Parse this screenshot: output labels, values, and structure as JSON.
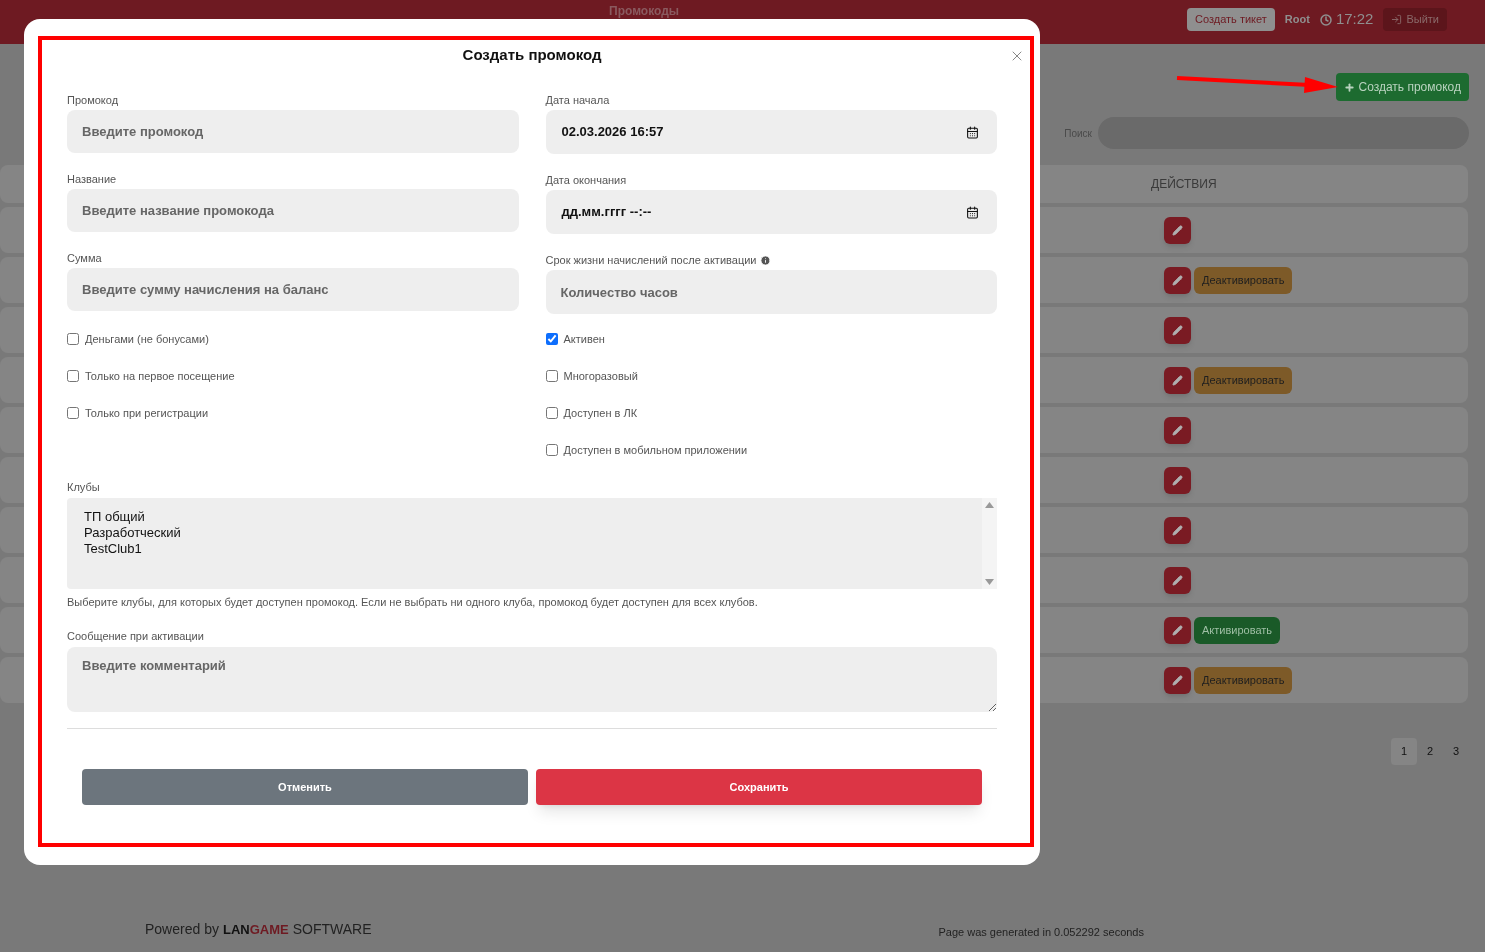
{
  "header": {
    "title": "Промокоды",
    "ticket_button": "Создать тикет",
    "user": "Root",
    "time": "17:22",
    "logout": "Выйти"
  },
  "toolbar": {
    "create_button": "Создать промокод",
    "search_label": "Поиск"
  },
  "table": {
    "columns": [
      "ДЕЙСТВИЯ"
    ],
    "rows": [
      {
        "kind": "plain"
      },
      {
        "kind": "deactivate",
        "toggle": "Деактивировать"
      },
      {
        "kind": "plain"
      },
      {
        "kind": "deactivate",
        "toggle": "Деактивировать"
      },
      {
        "kind": "plain"
      },
      {
        "kind": "plain"
      },
      {
        "kind": "plain"
      },
      {
        "kind": "plain"
      },
      {
        "kind": "activate",
        "toggle": "Активировать"
      },
      {
        "kind": "deactivate",
        "toggle": "Деактивировать"
      }
    ]
  },
  "pagination": [
    {
      "label": "1",
      "selected": true
    },
    {
      "label": "2",
      "selected": false
    },
    {
      "label": "3",
      "selected": false
    }
  ],
  "modal": {
    "title": "Создать промокод",
    "fields_left": [
      {
        "label": "Промокод",
        "placeholder": "Введите промокод"
      },
      {
        "label": "Название",
        "placeholder": "Введите название промокода"
      },
      {
        "label": "Сумма",
        "placeholder": "Введите сумму начисления на баланс"
      }
    ],
    "fields_right": [
      {
        "kind": "date",
        "label": "Дата начала",
        "value": "02.03.2026 16:57"
      },
      {
        "kind": "date",
        "label": "Дата окончания",
        "value": "дд.мм.гггг --:--"
      },
      {
        "kind": "text",
        "label": "Срок жизни начислений после активации",
        "info": true,
        "placeholder": "Количество часов"
      }
    ],
    "checkboxes_left": [
      {
        "label": "Деньгами (не бонусами)",
        "checked": false
      },
      {
        "label": "Только на первое посещение",
        "checked": false
      },
      {
        "label": "Только при регистрации",
        "checked": false
      }
    ],
    "checkboxes_right": [
      {
        "label": "Активен",
        "checked": true
      },
      {
        "label": "Многоразовый",
        "checked": false
      },
      {
        "label": "Доступен в ЛК",
        "checked": false
      },
      {
        "label": "Доступен в мобильном приложении",
        "checked": false
      }
    ],
    "clubs": {
      "label": "Клубы",
      "options": [
        {
          "label": "ТП общий",
          "selected": false
        },
        {
          "label": "Разработческий",
          "selected": false
        },
        {
          "label": "TestClub1",
          "selected": false
        }
      ],
      "hint": "Выберите клубы, для которых будет доступен промокод. Если не выбрать ни одного клуба, промокод будет доступен для всех клубов."
    },
    "message": {
      "label": "Сообщение при активации",
      "placeholder": "Введите комментарий"
    },
    "buttons": {
      "cancel": "Отменить",
      "save": "Сохранить"
    }
  },
  "footer": {
    "powered": "Powered by",
    "logo_left": "LAN",
    "logo_right": "GAME",
    "logo_suffix": "SOFTWARE",
    "generated": "Page was generated in 0.052292 seconds"
  }
}
